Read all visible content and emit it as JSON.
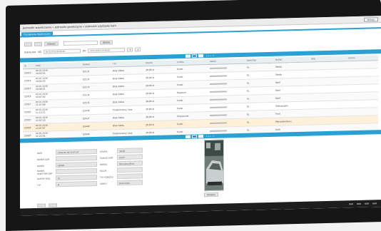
{
  "breadcrumb": [
    "Jednostki współczesne",
    "Jednostki geodezyjne",
    "Jednostki użytkowe kam"
  ],
  "title_button": "Wyloguj",
  "tab": "Przeglądarka Rejestracyjna",
  "toolbar": {
    "wide_button": "Odśwież",
    "search_button": "SZUKAJ"
  },
  "filters": {
    "from_label": "Zakres dat",
    "from_small": "OD",
    "from_value": "09.01.2016 00:00:00",
    "to_label": "DO",
    "to_value": "09.01.2016 23:59:59",
    "btn_a": "▾",
    "btn_b": "x"
  },
  "pager_top": "1 2 3 ... 5",
  "pager_bottom": "1 2 3 ... 5",
  "grid": {
    "headers": [
      "ID",
      "DATA",
      "NUMER",
      "TYP",
      "OPŁATA",
      "STREFA",
      "UWAGI",
      "PAŃSTWO",
      "MARKA",
      "OPIS",
      "STATUS"
    ],
    "rows": [
      {
        "id": "22013",
        "date": "09.01.2016\n10:03:14",
        "num": "E2131",
        "type": "Brak biletu",
        "fee": "30,00 zł",
        "zone": "Punkt",
        "country": "PL",
        "make": "Skoda",
        "alt": true
      },
      {
        "id": "22014",
        "date": "09.01.2016\n10:04:50",
        "num": "E2132",
        "type": "Brak biletu",
        "fee": "30,00 zł",
        "zone": "Punkt",
        "country": "PL",
        "make": "Skoda",
        "alt": false
      },
      {
        "id": "22015",
        "date": "09.01.2016\n10:06:21",
        "num": "E2133",
        "type": "Brak biletu",
        "fee": "30,00 zł",
        "zone": "Punkt",
        "country": "PL",
        "make": "Opel",
        "alt": true
      },
      {
        "id": "22016",
        "date": "09.01.2016\n10:07:40",
        "num": "E2134",
        "type": "Brak biletu",
        "fee": "30,00 zł",
        "zone": "Muzeum",
        "country": "PL",
        "make": "Opel",
        "alt": false
      },
      {
        "id": "22017",
        "date": "09.01.2016\n11:07:09",
        "num": "E2135",
        "type": "Brak biletu",
        "fee": "30,00 zł",
        "zone": "Punkt",
        "country": "PL",
        "make": "Opel",
        "alt": true
      },
      {
        "id": "22022",
        "date": "09.01.2016\n11:15:11",
        "num": "E2436",
        "type": "Przekroczony czas",
        "fee": "30,00 zł",
        "zone": "Punkt",
        "country": "PL",
        "make": "Volkswagen",
        "alt": false
      },
      {
        "id": "22023",
        "date": "09.01.2016\n12:07:30",
        "num": "E2437",
        "type": "Brak biletu",
        "fee": "30,00 zł",
        "zone": "Przystanek",
        "country": "PL",
        "make": "Ford",
        "alt": true
      },
      {
        "id": "22024",
        "date": "09.01.2016\n12:07:07",
        "num": "E2448",
        "type": "Brak biletu",
        "fee": "30,00 zł",
        "zone": "Punkt",
        "country": "PL",
        "make": "Mercedes-Benz",
        "alt": false,
        "sel": true
      },
      {
        "id": "22025",
        "date": "09.01.2016\n12:22:26",
        "num": "E2449",
        "type": "Przekroczony czas",
        "fee": "30,00 zł",
        "zone": "Punkt",
        "country": "PL",
        "make": "Audi",
        "alt": true
      }
    ]
  },
  "details": {
    "left_labels": [
      "DATA",
      "NUMER DOK",
      "NUMER",
      "NUMER REJESTRACYJNY",
      "RAPORT KOD",
      "TYP"
    ],
    "left_values": [
      "2016-01-09 12:07:07",
      "",
      "E2448",
      "",
      "PL",
      "B"
    ],
    "right_labels": [
      "OPŁATA",
      "ZAKŁAD DOK",
      "MARKA",
      "KOLOR",
      "TYP POJAZDU",
      "UWAGI"
    ],
    "right_values": [
      "30,00",
      "Punkt",
      "Mercedes-Benz",
      "",
      "",
      "Brak biletu"
    ]
  },
  "photo_button": "Powiększ",
  "colors": {
    "accent": "#2aa1d2",
    "selected_row": "#fff1d9"
  }
}
